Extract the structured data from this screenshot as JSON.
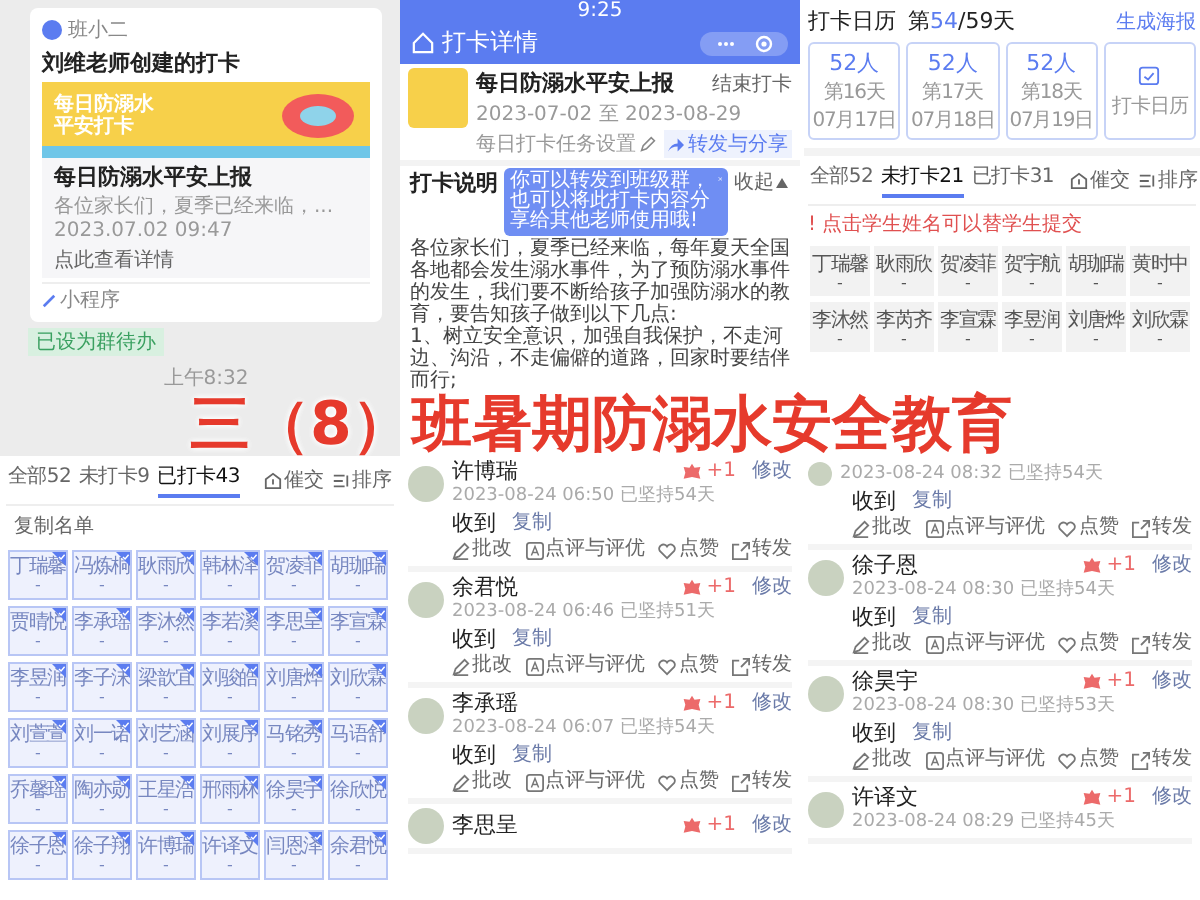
{
  "chat": {
    "sender": "班小二",
    "card_title": "刘维老师创建的打卡",
    "banner_lines": [
      "每日防溺水",
      "平安打卡"
    ],
    "item_title": "每日防溺水平安上报",
    "excerpt": "各位家长们，夏季已经来临，...",
    "date": "2023.07.02 09:47",
    "link": "点此查看详情",
    "source": "小程序",
    "badge": "已设为群待办",
    "time": "上午8:32"
  },
  "detail": {
    "status_time": "9:25",
    "title": "打卡详情",
    "task_title": "每日防溺水平安上报",
    "range": "2023-07-02 至 2023-08-29",
    "end_button": "结束打卡",
    "settings": "每日打卡任务设置",
    "share": "转发与分享",
    "tooltip": "你可以转发到班级群，也可以将此打卡内容分享给其他老师使用哦!",
    "section": "打卡说明",
    "collapse": "收起",
    "paragraphs": [
      "各位家长们，夏季已经来临，每年夏天全国各地都会发生溺水事件，为了预防溺水事件的发生，我们要不断给孩子加强防溺水的教育，要告知孩子做到以下几点:",
      "1、树立安全意识，加强自我保护，不走河边、沟沿，不走偏僻的道路，回家时要结伴而行;"
    ]
  },
  "calendar": {
    "title": "打卡日历",
    "day_prefix": "第",
    "day_current": "54",
    "day_rest": "/59天",
    "poster": "生成海报",
    "days": [
      {
        "count": "52人",
        "day": "第16天",
        "date": "07月17日"
      },
      {
        "count": "52人",
        "day": "第17天",
        "date": "07月18日"
      },
      {
        "count": "52人",
        "day": "第18天",
        "date": "07月19日"
      }
    ],
    "calendar_button": "打卡日历"
  },
  "pending": {
    "tabs": [
      {
        "label": "全部52",
        "selected": false
      },
      {
        "label": "未打卡21",
        "selected": true
      },
      {
        "label": "已打卡31",
        "selected": false
      }
    ],
    "urge": "催交",
    "sort": "排序",
    "notice": "! 点击学生姓名可以替学生提交",
    "students": [
      {
        "name": "丁瑞馨",
        "note": "-",
        "checked": false
      },
      {
        "name": "耿雨欣",
        "note": "-",
        "checked": false
      },
      {
        "name": "贺凌菲",
        "note": "-",
        "checked": false
      },
      {
        "name": "贺宇航",
        "note": "-",
        "checked": false
      },
      {
        "name": "胡珈瑞",
        "note": "-",
        "checked": false
      },
      {
        "name": "黄时中",
        "note": "-",
        "checked": false
      },
      {
        "name": "李沐然",
        "note": "-",
        "checked": false
      },
      {
        "name": "李芮齐",
        "note": "-",
        "checked": false
      },
      {
        "name": "李宣霖",
        "note": "-",
        "checked": false
      },
      {
        "name": "李昱润",
        "note": "-",
        "checked": false
      },
      {
        "name": "刘唐烨",
        "note": "-",
        "checked": false
      },
      {
        "name": "刘欣霖",
        "note": "-",
        "checked": false
      }
    ]
  },
  "title_overlay": "三（8）班暑期防溺水安全教育",
  "done": {
    "tabs": [
      {
        "label": "全部52",
        "selected": false
      },
      {
        "label": "未打卡9",
        "selected": false
      },
      {
        "label": "已打卡43",
        "selected": true
      }
    ],
    "urge": "催交",
    "sort": "排序",
    "copy": "复制名单",
    "students": [
      {
        "name": "丁瑞馨",
        "note": "-",
        "checked": true
      },
      {
        "name": "冯炼桐",
        "note": "-",
        "checked": true
      },
      {
        "name": "耿雨欣",
        "note": "-",
        "checked": true
      },
      {
        "name": "韩林泽",
        "note": "-",
        "checked": true
      },
      {
        "name": "贺凌菲",
        "note": "-",
        "checked": true
      },
      {
        "name": "胡珈瑞",
        "note": "-",
        "checked": true
      },
      {
        "name": "贾晴悦",
        "note": "-",
        "checked": true
      },
      {
        "name": "李承瑶",
        "note": "-",
        "checked": true
      },
      {
        "name": "李沐然",
        "note": "-",
        "checked": true
      },
      {
        "name": "李若溪",
        "note": "-",
        "checked": true
      },
      {
        "name": "李思呈",
        "note": "-",
        "checked": true
      },
      {
        "name": "李宣霖",
        "note": "-",
        "checked": true
      },
      {
        "name": "李昱润",
        "note": "-",
        "checked": true
      },
      {
        "name": "李子沫",
        "note": "-",
        "checked": true
      },
      {
        "name": "梁歆宜",
        "note": "-",
        "checked": true
      },
      {
        "name": "刘骏皓",
        "note": "-",
        "checked": true
      },
      {
        "name": "刘唐烨",
        "note": "-",
        "checked": true
      },
      {
        "name": "刘欣霖",
        "note": "-",
        "checked": true
      },
      {
        "name": "刘萱萱",
        "note": "-",
        "checked": true
      },
      {
        "name": "刘一诺",
        "note": "-",
        "checked": true
      },
      {
        "name": "刘艺涵",
        "note": "-",
        "checked": true
      },
      {
        "name": "刘展序",
        "note": "-",
        "checked": true
      },
      {
        "name": "马铭秀",
        "note": "-",
        "checked": true
      },
      {
        "name": "马语舒",
        "note": "-",
        "checked": true
      },
      {
        "name": "乔馨瑶",
        "note": "-",
        "checked": true
      },
      {
        "name": "陶亦勋",
        "note": "-",
        "checked": true
      },
      {
        "name": "王星浩",
        "note": "-",
        "checked": true
      },
      {
        "name": "邢雨林",
        "note": "-",
        "checked": true
      },
      {
        "name": "徐昊宇",
        "note": "-",
        "checked": true
      },
      {
        "name": "徐欣悦",
        "note": "-",
        "checked": true
      },
      {
        "name": "徐子恩",
        "note": "-",
        "checked": true
      },
      {
        "name": "徐子翔",
        "note": "-",
        "checked": true
      },
      {
        "name": "许博瑞",
        "note": "-",
        "checked": true
      },
      {
        "name": "许译文",
        "note": "-",
        "checked": true
      },
      {
        "name": "闫恩泽",
        "note": "-",
        "checked": true
      },
      {
        "name": "余君悦",
        "note": "-",
        "checked": true
      }
    ]
  },
  "feed_middle": [
    {
      "kind": "full",
      "name": "许博瑞",
      "time": "2023-08-24 06:50",
      "streak": "已坚持54天",
      "likes": "+1",
      "edit": "修改",
      "reply": "收到",
      "copy": "复制",
      "actions": [
        "批改",
        "点评与评优",
        "点赞",
        "转发"
      ]
    },
    {
      "kind": "full",
      "name": "余君悦",
      "time": "2023-08-24 06:46",
      "streak": "已坚持51天",
      "likes": "+1",
      "edit": "修改",
      "reply": "收到",
      "copy": "复制",
      "actions": [
        "批改",
        "点评与评优",
        "点赞",
        "转发"
      ]
    },
    {
      "kind": "full",
      "name": "李承瑶",
      "time": "2023-08-24 06:07",
      "streak": "已坚持54天",
      "likes": "+1",
      "edit": "修改",
      "reply": "收到",
      "copy": "复制",
      "actions": [
        "批改",
        "点评与评优",
        "点赞",
        "转发"
      ]
    },
    {
      "kind": "cut",
      "name": "李思呈",
      "likes": "+1",
      "edit": "修改"
    }
  ],
  "feed_right": [
    {
      "kind": "nameless",
      "time": "2023-08-24 08:32",
      "streak": "已坚持54天",
      "reply": "收到",
      "copy": "复制",
      "actions": [
        "批改",
        "点评与评优",
        "点赞",
        "转发"
      ]
    },
    {
      "kind": "full",
      "name": "徐子恩",
      "time": "2023-08-24 08:30",
      "streak": "已坚持54天",
      "likes": "+1",
      "edit": "修改",
      "reply": "收到",
      "copy": "复制",
      "actions": [
        "批改",
        "点评与评优",
        "点赞",
        "转发"
      ]
    },
    {
      "kind": "full",
      "name": "徐昊宇",
      "time": "2023-08-24 08:30",
      "streak": "已坚持53天",
      "likes": "+1",
      "edit": "修改",
      "reply": "收到",
      "copy": "复制",
      "actions": [
        "批改",
        "点评与评优",
        "点赞",
        "转发"
      ]
    },
    {
      "kind": "cut",
      "name": "许译文",
      "time": "2023-08-24 08:29",
      "streak": "已坚持45天",
      "likes": "+1",
      "edit": "修改"
    }
  ]
}
